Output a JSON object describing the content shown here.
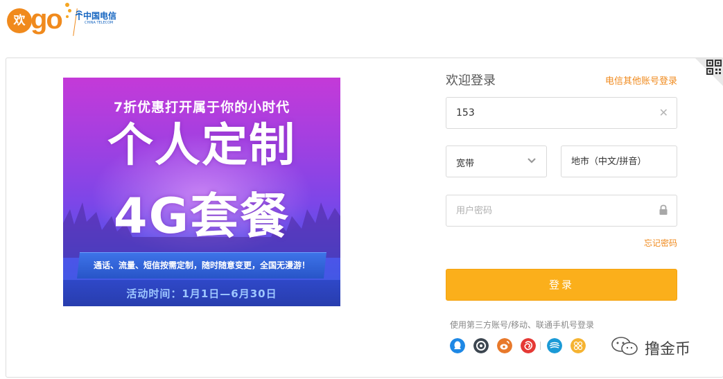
{
  "header": {
    "logo_text": "欢go",
    "carrier_name": "中国电信",
    "carrier_sub": "CHINA TELECOM"
  },
  "banner": {
    "subtitle": "7折优惠打开属于你的小时代",
    "headline_1": "个人定制",
    "headline_2": "4G套餐",
    "tagline": "通话、流量、短信按需定制，随时随意变更，全国无漫游！",
    "period": "活动时间：1月1日—6月30日"
  },
  "login": {
    "title": "欢迎登录",
    "other_account_link": "电信其他账号登录",
    "phone_value": "153",
    "account_type": "宽带",
    "city_placeholder": "地市（中文/拼音）",
    "password_placeholder": "用户密码",
    "forgot_password": "忘记密码",
    "submit_label": "登录",
    "third_party_text": "使用第三方账号/移动、联通手机号登录",
    "social_icons": [
      "qq-icon",
      "alipay-icon",
      "weibo-icon",
      "netease-icon",
      "mobile-icon",
      "unicom-icon"
    ]
  },
  "watermark": {
    "text": "撸金币"
  },
  "colors": {
    "brand_orange": "#f08a1d",
    "button_yellow": "#fbaf1b",
    "telecom_blue": "#1565c0"
  }
}
